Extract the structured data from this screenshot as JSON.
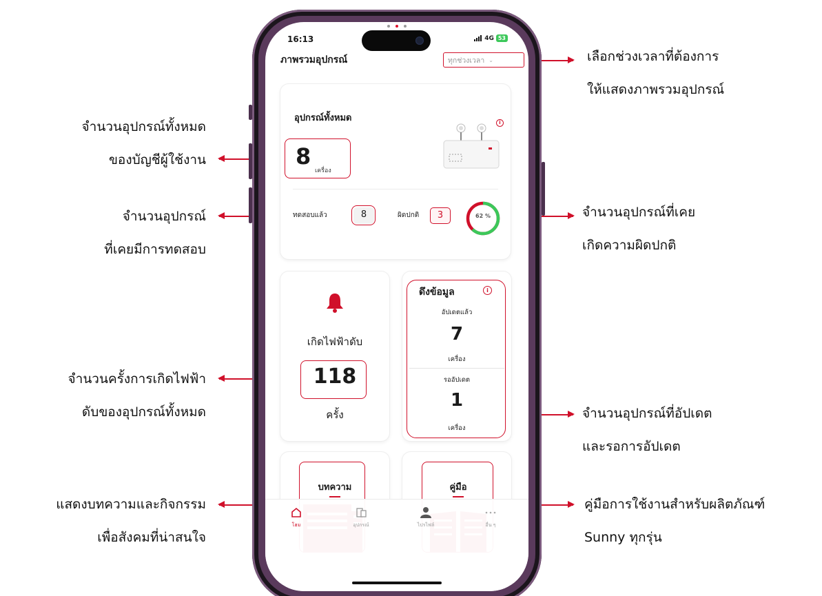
{
  "status_bar": {
    "time": "16:13",
    "signal": "4G",
    "battery": "53"
  },
  "header": {
    "title": "ภาพรวมอุปกรณ์",
    "range_select": {
      "value": "ทุกช่วงเวลา"
    }
  },
  "total_card": {
    "title": "อุปกรณ์ทั้งหมด",
    "count": "8",
    "unit": "เครื่อง",
    "tested_label": "ทดสอบแล้ว",
    "tested_count": "8",
    "abnormal_label": "ผิดปกติ",
    "abnormal_count": "3",
    "gauge_percent": "62 %",
    "gauge_value": 62
  },
  "outage_card": {
    "label": "เกิดไฟฟ้าดับ",
    "count": "118",
    "unit": "ครั้ง"
  },
  "pull_card": {
    "title": "ดึงข้อมูล",
    "updated_label": "อัปเดตแล้ว",
    "updated_count": "7",
    "updated_unit": "เครื่อง",
    "pending_label": "รออัปเดต",
    "pending_count": "1",
    "pending_unit": "เครื่อง"
  },
  "article_card": {
    "title": "บทความ"
  },
  "manual_card": {
    "title": "คู่มือ"
  },
  "tabbar": {
    "items": [
      {
        "label": "โฮม"
      },
      {
        "label": "อุปกรณ์"
      },
      {
        "label": "ไปรไฟล์"
      },
      {
        "label": "อื่น ๆ"
      }
    ]
  },
  "annotations": {
    "range_line1": "เลือกช่วงเวลาที่ต้องการ",
    "range_line2": "ให้แสดงภาพรวมอุปกรณ์",
    "total_line1": "จำนวนอุปกรณ์ทั้งหมด",
    "total_line2": "ของบัญชีผู้ใช้งาน",
    "tested_line1": "จำนวนอุปกรณ์",
    "tested_line2": "ที่เคยมีการทดสอบ",
    "abnormal_line1": "จำนวนอุปกรณ์ที่เคย",
    "abnormal_line2": "เกิดความผิดปกติ",
    "outage_line1": "จำนวนครั้งการเกิดไฟฟ้า",
    "outage_line2": "ดับของอุปกรณ์ทั้งหมด",
    "update_line1": "จำนวนอุปกรณ์ที่อัปเดต",
    "update_line2": "และรอการอัปเดต",
    "article_line1": "แสดงบทความและกิจกรรม",
    "article_line2": "เพื่อสังคมที่น่าสนใจ",
    "manual_line1": "คู่มือการใช้งานสำหรับผลิตภัณฑ์",
    "manual_line2": "Sunny ทุกรุ่น"
  },
  "colors": {
    "accent": "#d0102a",
    "gauge_good": "#3cc85a",
    "frame": "#5a3a5c"
  }
}
